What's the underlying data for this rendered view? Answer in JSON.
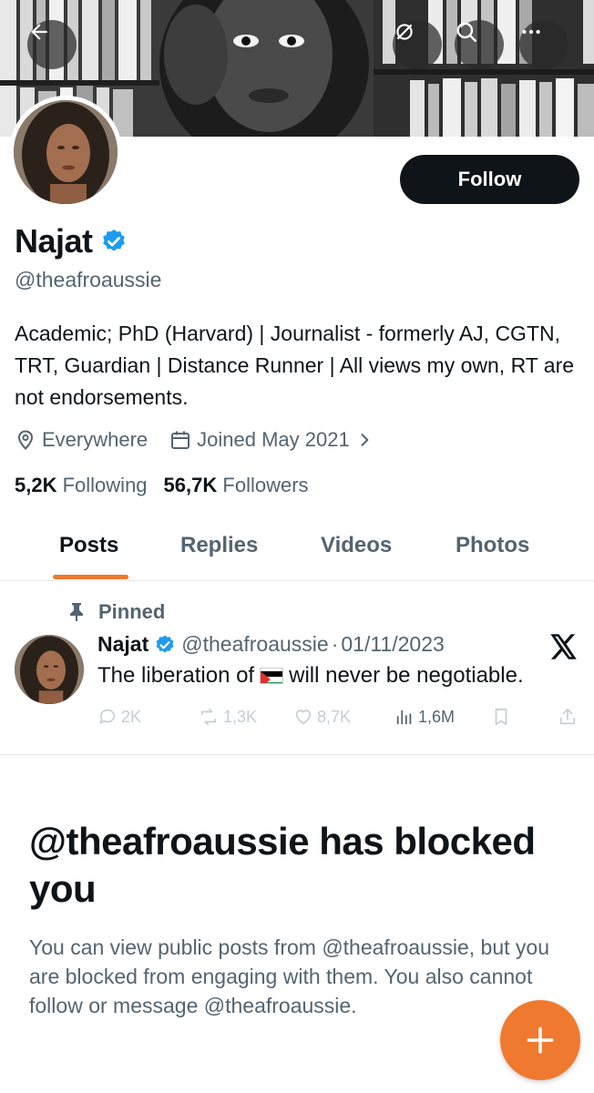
{
  "header": {
    "back_icon": "back-arrow-icon",
    "grok_icon": "grok-icon",
    "search_icon": "search-icon",
    "more_icon": "more-icon"
  },
  "profile": {
    "follow_label": "Follow",
    "display_name": "Najat",
    "handle": "@theafroaussie",
    "bio": "Academic; PhD (Harvard) | Journalist - formerly AJ, CGTN, TRT, Guardian | Distance Runner | All views my own, RT are not endorsements.",
    "location": "Everywhere",
    "joined": "Joined May 2021",
    "following_count": "5,2K",
    "following_label": "Following",
    "followers_count": "56,7K",
    "followers_label": "Followers"
  },
  "tabs": [
    {
      "label": "Posts",
      "active": true
    },
    {
      "label": "Replies",
      "active": false
    },
    {
      "label": "Videos",
      "active": false
    },
    {
      "label": "Photos",
      "active": false
    }
  ],
  "pinned_tweet": {
    "pinned_label": "Pinned",
    "name": "Najat",
    "handle": "@theafroaussie",
    "separator": "·",
    "date": "01/11/2023",
    "text_before": "The liberation of",
    "text_after": "will never be negotiable.",
    "replies": "2K",
    "reposts": "1,3K",
    "likes": "8,7K",
    "views": "1,6M"
  },
  "blocked": {
    "title": "@theafroaussie has blocked you",
    "description": "You can view public posts from @theafroaussie, but you are blocked from engaging with them. You also cannot follow or message @theafroaussie."
  },
  "colors": {
    "accent": "#ef7a2f",
    "verified": "#1d9bf0",
    "text_primary": "#0f1419",
    "text_secondary": "#536471"
  }
}
